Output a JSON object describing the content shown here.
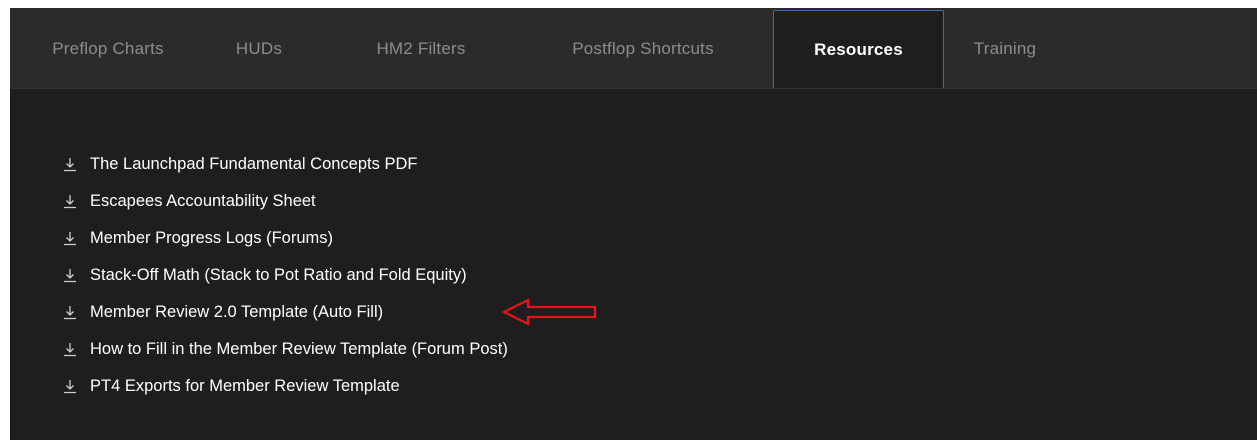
{
  "tabs": [
    {
      "label": "Preflop Charts",
      "active": false
    },
    {
      "label": "HUDs",
      "active": false
    },
    {
      "label": "HM2 Filters",
      "active": false
    },
    {
      "label": "Postflop Shortcuts",
      "active": false
    },
    {
      "label": "Resources",
      "active": true
    },
    {
      "label": "Training",
      "active": false
    }
  ],
  "resources": {
    "item_icon": "download-icon",
    "items": [
      {
        "label": "The Launchpad Fundamental Concepts PDF"
      },
      {
        "label": "Escapees Accountability Sheet"
      },
      {
        "label": "Member Progress Logs (Forums)"
      },
      {
        "label": "Stack-Off Math (Stack to Pot Ratio and Fold Equity)"
      },
      {
        "label": "Member Review 2.0 Template (Auto Fill)"
      },
      {
        "label": "How to Fill in the Member Review Template (Forum Post)"
      },
      {
        "label": "PT4 Exports for Member Review Template"
      }
    ]
  },
  "annotation": {
    "icon": "left-arrow-annotation",
    "points_to_item": "Member Review 2.0 Template (Auto Fill)",
    "color": "#e8161b"
  },
  "colors": {
    "background": "#1e1e1e",
    "tab_bar": "#2b2b2b",
    "active_tab_border": "#3d6cb3",
    "inactive_tab_text": "#8c8c8c",
    "text": "#ffffff"
  }
}
